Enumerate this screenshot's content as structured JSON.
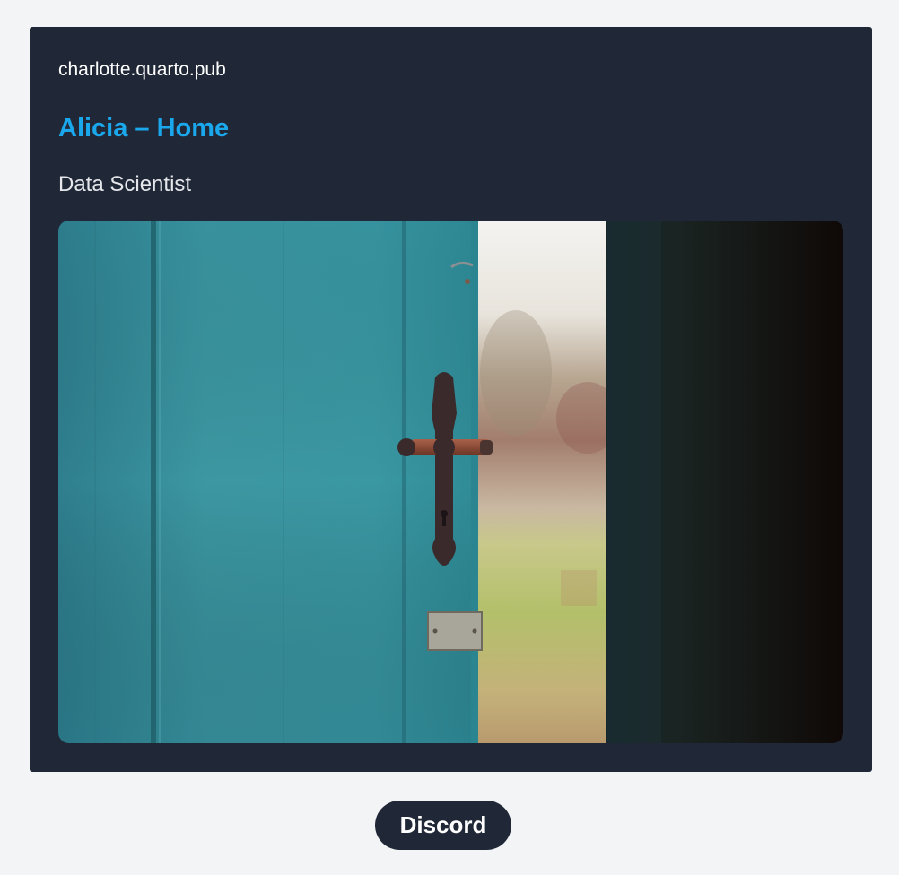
{
  "card": {
    "site_url": "charlotte.quarto.pub",
    "title": "Alicia – Home",
    "subtitle": "Data Scientist",
    "image": {
      "subject": "open-door-photo"
    }
  },
  "footer": {
    "discord_label": "Discord"
  },
  "colors": {
    "page_background": "#f3f4f6",
    "card_background": "#202837",
    "title_accent": "#1aa7ec",
    "button_background": "#202837",
    "button_text": "#ffffff"
  }
}
